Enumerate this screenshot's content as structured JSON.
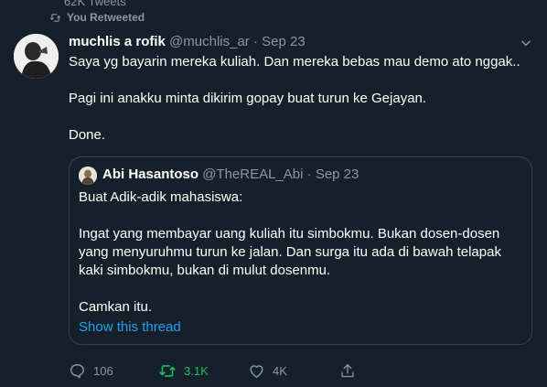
{
  "profile_tweet_count": "62K Tweets",
  "retweet_note": "You Retweeted",
  "tweet": {
    "author_name": "muchlis a rofik",
    "author_handle": "@muchlis_ar",
    "separator": "·",
    "date": "Sep 23",
    "paragraphs": [
      "Saya yg bayarin mereka kuliah. Dan mereka bebas mau demo ato nggak..",
      "Pagi ini anakku minta dikirim gopay buat turun ke Gejayan.",
      "Done."
    ]
  },
  "quoted_tweet": {
    "author_name": "Abi Hasantoso",
    "author_handle": "@TheREAL_Abi",
    "separator": "·",
    "date": "Sep 23",
    "paragraphs": [
      "Buat Adik-adik mahasiswa:",
      "Ingat yang membayar uang kuliah itu simbokmu. Bukan dosen-dosen yang menyuruhmu turun ke jalan. Dan surga itu ada di bawah telapak kaki simbokmu, bukan di mulut dosenmu.",
      "Camkan itu."
    ],
    "show_thread_label": "Show this thread"
  },
  "actions": {
    "reply_count": "106",
    "retweet_count": "3.1K",
    "like_count": "4K"
  },
  "colors": {
    "background": "#15202b",
    "text_primary": "#ffffff",
    "text_secondary": "#8899a6",
    "link": "#1da1f2",
    "retweeted": "#17bf63",
    "border": "#38444d"
  },
  "icons": [
    "retweet-icon",
    "chevron-down-icon",
    "reply-icon",
    "retweet-icon",
    "like-icon",
    "share-icon"
  ]
}
